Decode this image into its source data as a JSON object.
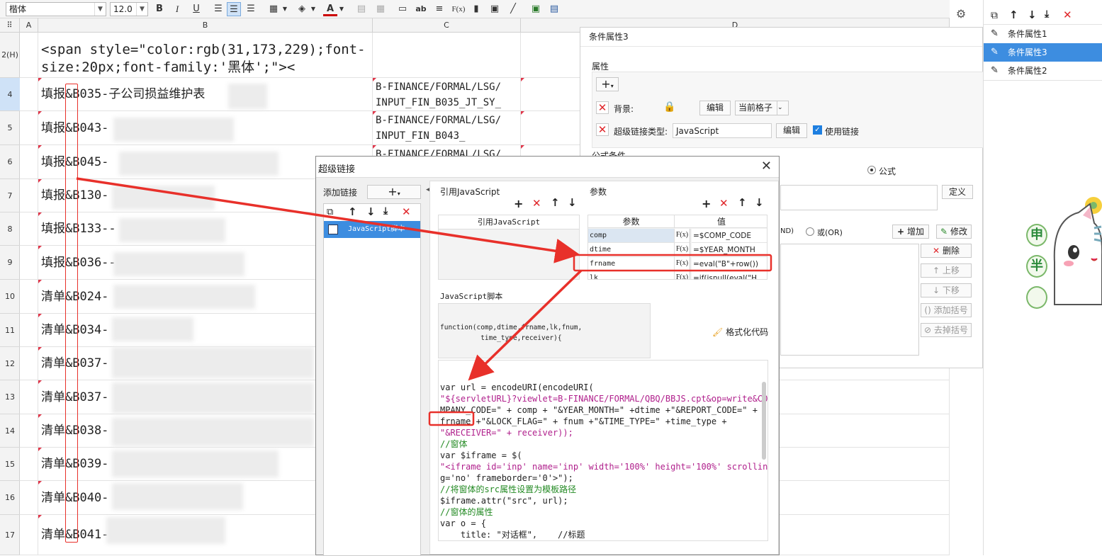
{
  "toolbar": {
    "font_name": "楷体",
    "font_size": "12.0",
    "bold": "B",
    "italic": "I",
    "underline": "U",
    "text_color": "A",
    "fx": "F(x)",
    "ab": "ab"
  },
  "columns": {
    "row_header": "",
    "a": "A",
    "b": "B",
    "c": "C",
    "d": "D"
  },
  "rows": [
    {
      "num": "2(H)",
      "b": "<span style=\"color:rgb(31,173,229);font-size:20px;font-family:'黑体';\"><",
      "c": ""
    },
    {
      "num": "4",
      "b": "填报&B035-子公司损益维护表",
      "c": "B-FINANCE/FORMAL/LSG/ INPUT_FIN_B035_JT_SY_"
    },
    {
      "num": "5",
      "b": "填报&B043-",
      "c": "B-FINANCE/FORMAL/LSG/ INPUT_FIN_B043_"
    },
    {
      "num": "6",
      "b": "填报&B045-",
      "c": "B-FINANCE/FORMAL/LSG/"
    },
    {
      "num": "7",
      "b": "填报&B130-",
      "c": ""
    },
    {
      "num": "8",
      "b": "填报&B133--",
      "c": ""
    },
    {
      "num": "9",
      "b": "填报&B036--",
      "c": ""
    },
    {
      "num": "10",
      "b": "清单&B024-",
      "c": ""
    },
    {
      "num": "11",
      "b": "清单&B034-",
      "c": ""
    },
    {
      "num": "12",
      "b": "清单&B037-",
      "c": ""
    },
    {
      "num": "13",
      "b": "清单&B037-",
      "c": ""
    },
    {
      "num": "14",
      "b": "清单&B038-",
      "c": ""
    },
    {
      "num": "15",
      "b": "清单&B039-",
      "c": ""
    },
    {
      "num": "16",
      "b": "清单&B040-",
      "c": ""
    },
    {
      "num": "17",
      "b": "清单&B041-",
      "c": ""
    }
  ],
  "cond_panel": {
    "title": "条件属性3",
    "attr_label": "属性",
    "bg_label": "背景:",
    "edit1": "编辑",
    "current_cell": "当前格子",
    "link_type_label": "超级链接类型:",
    "link_type_value": "JavaScript",
    "edit2": "编辑",
    "use_link": "使用链接",
    "formula_cond": "公式条件",
    "formula_radio": "公式",
    "define": "定义",
    "and_label": "ND)",
    "or_label": "或(OR)",
    "add_btn": "增加",
    "modify_btn": "修改",
    "delete_btn": "删除",
    "up_btn": "上移",
    "down_btn": "下移",
    "add_bracket": "添加括号",
    "remove_bracket": "去掉括号"
  },
  "cond_list": {
    "items": [
      "条件属性1",
      "条件属性3",
      "条件属性2"
    ]
  },
  "dialog": {
    "title": "超级链接",
    "add_link_label": "添加链接",
    "link_item": "JavaScript脚本",
    "ref_js_label": "引用JavaScript",
    "ref_js_header": "引用JavaScript",
    "params_label": "参数",
    "param_col": "参数",
    "value_col": "值",
    "params": [
      {
        "name": "comp",
        "fx": "F(x)",
        "value": "=$COMP_CODE"
      },
      {
        "name": "dtime",
        "fx": "F(x)",
        "value": "=$YEAR_MONTH"
      },
      {
        "name": "frname",
        "fx": "F(x)",
        "value": "=eval(\"B\"+row())"
      },
      {
        "name": "lk",
        "fx": "F(x)",
        "value": "=if(isnull(eval(\"H"
      }
    ],
    "js_label": "JavaScript脚本",
    "format_code": "格式化代码",
    "signature_line1": "function(comp,dtime,frname,lk,fnum,",
    "signature_line2": "          time_type,receiver){",
    "code_lines": [
      "var url = encodeURI(encodeURI(",
      "\"${servletURL}?viewlet=B-FINANCE/FORMAL/QBQ/BBJS.cpt&op=write&CO",
      "MPANY_CODE=\" + comp + \"&YEAR_MONTH=\" +dtime +\"&REPORT_CODE=\" +",
      "frname +\"&LOCK_FLAG=\" + fnum +\"&TIME_TYPE=\" +time_type +",
      "\"&RECEIVER=\" + receiver));",
      "//窗体",
      "var $iframe = $(",
      "\"<iframe id='inp' name='inp' width='100%' height='100%' scrollin",
      "g='no' frameborder='0'>\");",
      "//将窗体的src属性设置为模板路径",
      "$iframe.attr(\"src\", url);",
      "//窗体的属性",
      "var o = {",
      "    title: \"对话框\",    //标题",
      "}"
    ]
  },
  "sticker": {
    "chars": [
      "申",
      "半"
    ]
  }
}
